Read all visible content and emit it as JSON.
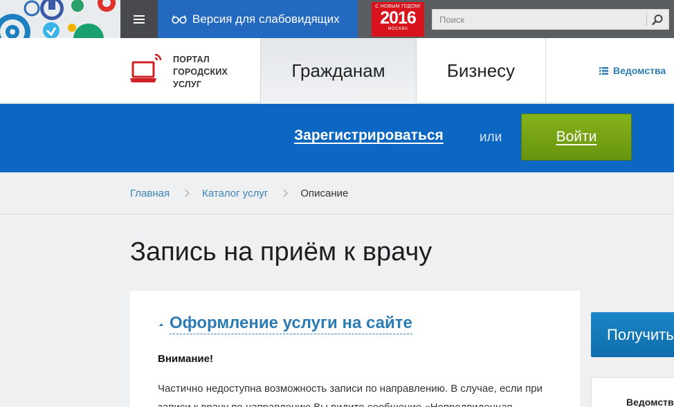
{
  "topbar": {
    "vision_label": "Версия для слабовидящих",
    "newyear_badge": {
      "line1": "С НОВЫМ ГОДОМ!",
      "year": "2016",
      "city": "МОСКВА"
    },
    "search_placeholder": "Поиск"
  },
  "header": {
    "logo_lines": [
      "ПОРТАЛ",
      "ГОРОДСКИХ",
      "УСЛУГ"
    ],
    "nav": {
      "citizens": "Гражданам",
      "business": "Бизнесу",
      "departments": "Ведомства"
    }
  },
  "auth": {
    "register": "Зарегистрироваться",
    "or": "или",
    "login": "Войти"
  },
  "breadcrumb": {
    "home": "Главная",
    "catalog": "Каталог услуг",
    "current": "Описание"
  },
  "main": {
    "title": "Запись на приём к врачу",
    "section_title": "Оформление услуги на сайте",
    "warning_title": "Внимание!",
    "warning_text": "Частично недоступна возможность записи по направлению. В случае, если при записи к врачу по направлению Вы видите сообщение «Непредвиденная"
  },
  "sidebar": {
    "get_button": "Получить",
    "box_title": "Ведомства"
  },
  "colors": {
    "accent_blue": "#0b67c2",
    "login_green": "#7aa817",
    "link_blue": "#2b7cb4",
    "badge_red": "#d8131b"
  }
}
